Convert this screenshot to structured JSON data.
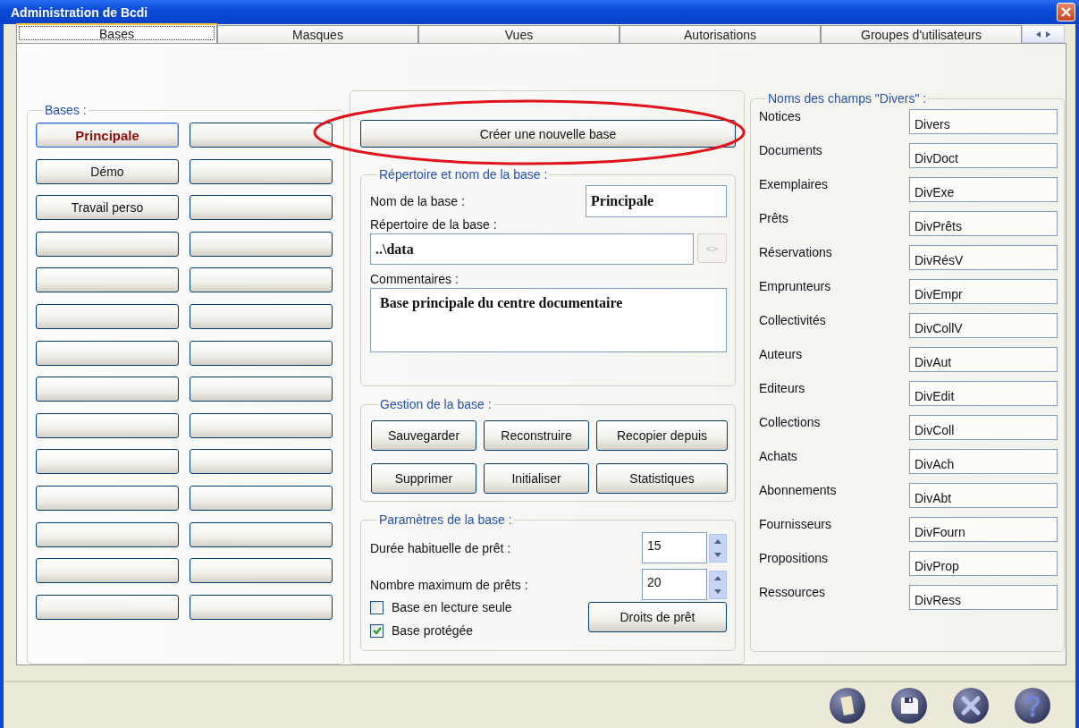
{
  "window": {
    "title": "Administration de Bcdi"
  },
  "tabs": [
    {
      "label": "Bases",
      "selected": true
    },
    {
      "label": "Masques",
      "selected": false
    },
    {
      "label": "Vues",
      "selected": false
    },
    {
      "label": "Autorisations",
      "selected": false
    },
    {
      "label": "Groupes d'utilisateurs",
      "selected": false
    }
  ],
  "bases_group": {
    "title": "Bases :",
    "items": [
      {
        "label": "Principale",
        "selected": true
      },
      {
        "label": "Démo",
        "selected": false
      },
      {
        "label": "Travail perso",
        "selected": false
      },
      {
        "selected": false
      },
      {
        "selected": false
      },
      {
        "selected": false
      },
      {
        "selected": false
      },
      {
        "selected": false
      },
      {
        "selected": false
      },
      {
        "selected": false
      },
      {
        "selected": false
      },
      {
        "selected": false
      },
      {
        "selected": false
      },
      {
        "selected": false
      },
      {
        "selected": false
      },
      {
        "selected": false
      },
      {
        "selected": false
      },
      {
        "selected": false
      },
      {
        "selected": false
      },
      {
        "selected": false
      },
      {
        "selected": false
      },
      {
        "selected": false
      },
      {
        "selected": false
      },
      {
        "selected": false
      },
      {
        "selected": false
      },
      {
        "selected": false
      },
      {
        "selected": false
      },
      {
        "selected": false
      }
    ]
  },
  "create_button": {
    "label": "Créer une nouvelle base",
    "highlighted": true
  },
  "directory_group": {
    "title": "Répertoire et nom de la base :",
    "name_label": "Nom de la base :",
    "name_value": "Principale",
    "dir_label": "Répertoire de la base :",
    "dir_value": "..\\data",
    "browse_label": "<>",
    "browse_disabled": true,
    "comments_label": "Commentaires :",
    "comments_value": "Base principale du centre documentaire"
  },
  "management_group": {
    "title": "Gestion de la base :",
    "buttons": [
      "Sauvegarder",
      "Reconstruire",
      "Recopier depuis",
      "Supprimer",
      "Initialiser",
      "Statistiques"
    ]
  },
  "parameters_group": {
    "title": "Paramètres de la base :",
    "spinners": [
      {
        "label": "Durée habituelle de prêt :",
        "value": "15"
      },
      {
        "label": "Nombre maximum de prêts :",
        "value": "20"
      }
    ],
    "checkboxes": [
      {
        "label": "Base en lecture seule",
        "checked": false
      },
      {
        "label": "Base protégée",
        "checked": true
      }
    ],
    "button": "Droits de prêt"
  },
  "fields_group": {
    "title": "Noms des champs \"Divers\" :",
    "rows": [
      {
        "label": "Notices",
        "value": "Divers"
      },
      {
        "label": "Documents",
        "value": "DivDoct"
      },
      {
        "label": "Exemplaires",
        "value": "DivExe"
      },
      {
        "label": "Prêts",
        "value": "DivPrêts"
      },
      {
        "label": "Réservations",
        "value": "DivRésV"
      },
      {
        "label": "Emprunteurs",
        "value": "DivEmpr"
      },
      {
        "label": "Collectivités",
        "value": "DivCollV"
      },
      {
        "label": "Auteurs",
        "value": "DivAut"
      },
      {
        "label": "Editeurs",
        "value": "DivEdit"
      },
      {
        "label": "Collections",
        "value": "DivColl"
      },
      {
        "label": "Achats",
        "value": "DivAch"
      },
      {
        "label": "Abonnements",
        "value": "DivAbt"
      },
      {
        "label": "Fournisseurs",
        "value": "DivFourn"
      },
      {
        "label": "Propositions",
        "value": "DivProp"
      },
      {
        "label": "Ressources",
        "value": "DivRess"
      }
    ]
  },
  "footer_buttons": [
    {
      "kind": "document"
    },
    {
      "kind": "save"
    },
    {
      "kind": "close"
    },
    {
      "kind": "help"
    }
  ]
}
